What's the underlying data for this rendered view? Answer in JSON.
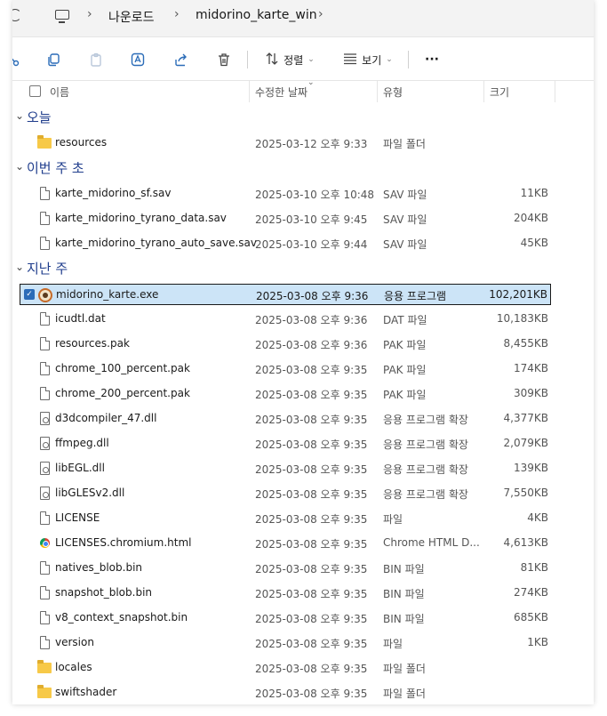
{
  "address": {
    "crumbs": [
      "나운로드",
      "midorino_karte_win"
    ]
  },
  "toolbar": {
    "sort_label": "정렬",
    "view_label": "보기",
    "more_label": "···"
  },
  "columns": {
    "name": "이름",
    "date": "수정한 날짜",
    "type": "유형",
    "size": "크기"
  },
  "groups": [
    {
      "title": "오늘",
      "rows": [
        {
          "icon": "folder-icon",
          "name": "resources",
          "date": "2025-03-12 오후 9:33",
          "type": "파일 폴더",
          "size": ""
        }
      ]
    },
    {
      "title": "이번 주 초",
      "rows": [
        {
          "icon": "file-icon",
          "name": "karte_midorino_sf.sav",
          "date": "2025-03-10 오후 10:48",
          "type": "SAV 파일",
          "size": "11KB"
        },
        {
          "icon": "file-icon",
          "name": "karte_midorino_tyrano_data.sav",
          "date": "2025-03-10 오후 9:45",
          "type": "SAV 파일",
          "size": "204KB"
        },
        {
          "icon": "file-icon",
          "name": "karte_midorino_tyrano_auto_save.sav",
          "date": "2025-03-10 오후 9:44",
          "type": "SAV 파일",
          "size": "45KB"
        }
      ]
    },
    {
      "title": "지난 주",
      "rows": [
        {
          "icon": "app-icon",
          "name": "midorino_karte.exe",
          "date": "2025-03-08 오후 9:36",
          "type": "응용 프로그램",
          "size": "102,201KB",
          "selected": true
        },
        {
          "icon": "file-icon",
          "name": "icudtl.dat",
          "date": "2025-03-08 오후 9:36",
          "type": "DAT 파일",
          "size": "10,183KB"
        },
        {
          "icon": "file-icon",
          "name": "resources.pak",
          "date": "2025-03-08 오후 9:36",
          "type": "PAK 파일",
          "size": "8,455KB"
        },
        {
          "icon": "file-icon",
          "name": "chrome_100_percent.pak",
          "date": "2025-03-08 오후 9:35",
          "type": "PAK 파일",
          "size": "174KB"
        },
        {
          "icon": "file-icon",
          "name": "chrome_200_percent.pak",
          "date": "2025-03-08 오후 9:35",
          "type": "PAK 파일",
          "size": "309KB"
        },
        {
          "icon": "dll-icon",
          "name": "d3dcompiler_47.dll",
          "date": "2025-03-08 오후 9:35",
          "type": "응용 프로그램 확장",
          "size": "4,377KB"
        },
        {
          "icon": "dll-icon",
          "name": "ffmpeg.dll",
          "date": "2025-03-08 오후 9:35",
          "type": "응용 프로그램 확장",
          "size": "2,079KB"
        },
        {
          "icon": "dll-icon",
          "name": "libEGL.dll",
          "date": "2025-03-08 오후 9:35",
          "type": "응용 프로그램 확장",
          "size": "139KB"
        },
        {
          "icon": "dll-icon",
          "name": "libGLESv2.dll",
          "date": "2025-03-08 오후 9:35",
          "type": "응용 프로그램 확장",
          "size": "7,550KB"
        },
        {
          "icon": "file-icon",
          "name": "LICENSE",
          "date": "2025-03-08 오후 9:35",
          "type": "파일",
          "size": "4KB"
        },
        {
          "icon": "chrome-icon",
          "name": "LICENSES.chromium.html",
          "date": "2025-03-08 오후 9:35",
          "type": "Chrome HTML D...",
          "size": "4,613KB"
        },
        {
          "icon": "file-icon",
          "name": "natives_blob.bin",
          "date": "2025-03-08 오후 9:35",
          "type": "BIN 파일",
          "size": "81KB"
        },
        {
          "icon": "file-icon",
          "name": "snapshot_blob.bin",
          "date": "2025-03-08 오후 9:35",
          "type": "BIN 파일",
          "size": "274KB"
        },
        {
          "icon": "file-icon",
          "name": "v8_context_snapshot.bin",
          "date": "2025-03-08 오후 9:35",
          "type": "BIN 파일",
          "size": "685KB"
        },
        {
          "icon": "file-icon",
          "name": "version",
          "date": "2025-03-08 오후 9:35",
          "type": "파일",
          "size": "1KB"
        },
        {
          "icon": "folder-icon",
          "name": "locales",
          "date": "2025-03-08 오후 9:35",
          "type": "파일 폴더",
          "size": ""
        },
        {
          "icon": "folder-icon",
          "name": "swiftshader",
          "date": "2025-03-08 오후 9:35",
          "type": "파일 폴더",
          "size": ""
        }
      ]
    }
  ],
  "colors": {
    "accent": "#2b6cb8",
    "group_title": "#1f3d8c",
    "selection_bg": "#cce4f7",
    "folder": "#f7c948"
  }
}
